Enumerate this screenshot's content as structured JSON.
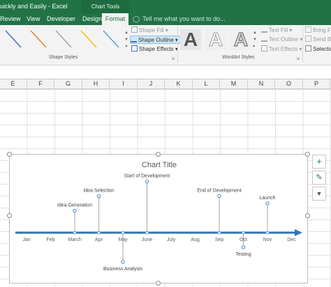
{
  "window": {
    "title": "uickly and Easily - Excel",
    "context_tab_group": "Chart Tools"
  },
  "tabs": [
    {
      "label": "Review"
    },
    {
      "label": "View"
    },
    {
      "label": "Developer"
    },
    {
      "label": "Design"
    },
    {
      "label": "Format"
    }
  ],
  "tell_me": {
    "placeholder": "Tell me what you want to do..."
  },
  "ribbon": {
    "shape_styles": {
      "label": "Shape Styles",
      "shape_fill": "Shape Fill",
      "shape_outline": "Shape Outline",
      "shape_effects": "Shape Effects",
      "swatch_colors": [
        "#4472c4",
        "#ed7d31",
        "#a5a5a5",
        "#ffc000",
        "#5b9bd5"
      ]
    },
    "wordart_styles": {
      "label": "WordArt Styles",
      "sample_letter": "A",
      "text_fill": "Text Fill",
      "text_outline": "Text Outline",
      "text_effects": "Text Effects"
    },
    "arrange": {
      "bring_forward": "Bring F",
      "send_backward": "Send B",
      "selection_pane": "Selectio"
    }
  },
  "columns": [
    "E",
    "F",
    "G",
    "H",
    "I",
    "J",
    "K",
    "L",
    "M",
    "N",
    "O",
    "P"
  ],
  "chart_data": {
    "type": "timeline",
    "title": "Chart Title",
    "axis_color": "#2e75b6",
    "stem_color": "#a5a5a5",
    "marker_color": "#5b9bd5",
    "categories": [
      "Jan",
      "Feb",
      "March",
      "Apr",
      "May",
      "June",
      "July",
      "Aug",
      "Sep",
      "Oct",
      "Nov",
      "Dec"
    ],
    "events": [
      {
        "label": "Idea Generation",
        "month": 3,
        "height": 15
      },
      {
        "label": "Idea Selection",
        "month": 4,
        "height": 25
      },
      {
        "label": "Business Analysis",
        "month": 5,
        "height": -20
      },
      {
        "label": "Start of Development",
        "month": 6,
        "height": 35
      },
      {
        "label": "End of Development",
        "month": 9,
        "height": 25
      },
      {
        "label": "Testing",
        "month": 10,
        "height": -10
      },
      {
        "label": "Launch",
        "month": 11,
        "height": 20
      }
    ]
  },
  "chart_buttons": [
    {
      "name": "chart-elements",
      "glyph": "+"
    },
    {
      "name": "chart-styles",
      "glyph": "✎"
    },
    {
      "name": "chart-filters",
      "glyph": "▼"
    }
  ]
}
